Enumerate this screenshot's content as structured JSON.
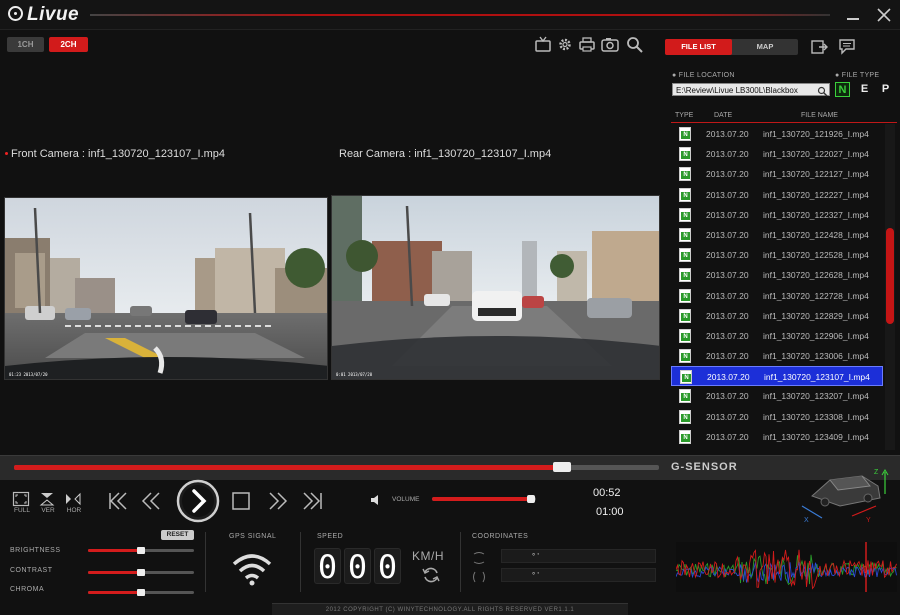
{
  "app": {
    "title": "Livue"
  },
  "window": {
    "minimize_icon": "minimize-icon",
    "close_icon": "close-icon"
  },
  "toolbar": {
    "channel_1": "1CH",
    "channel_2": "2CH",
    "tools": [
      "tv-icon",
      "settings-gear-icon",
      "printer-icon",
      "camera-icon",
      "search-icon"
    ]
  },
  "tabs": {
    "file_list": "FILE LIST",
    "map": "MAP"
  },
  "cameras": {
    "front_label": "Front Camera : inf1_130720_123107_I.mp4",
    "rear_label": "Rear Camera : inf1_130720_123107_I.mp4",
    "front_osd": "01:23 2013/07/20",
    "rear_osd": "0:01 2013/07/20"
  },
  "file_panel": {
    "location_label": "FILE LOCATION",
    "location_value": "E:\\Review\\Livue LB300L\\Blackbox",
    "file_type_label": "FILE TYPE",
    "file_types": [
      "N",
      "E",
      "P"
    ],
    "headers": {
      "type": "TYPE",
      "date": "DATE",
      "name": "FILE NAME"
    },
    "files": [
      {
        "date": "2013.07.20",
        "name": "inf1_130720_121926_I.mp4"
      },
      {
        "date": "2013.07.20",
        "name": "inf1_130720_122027_I.mp4"
      },
      {
        "date": "2013.07.20",
        "name": "inf1_130720_122127_I.mp4"
      },
      {
        "date": "2013.07.20",
        "name": "inf1_130720_122227_I.mp4"
      },
      {
        "date": "2013.07.20",
        "name": "inf1_130720_122327_I.mp4"
      },
      {
        "date": "2013.07.20",
        "name": "inf1_130720_122428_I.mp4"
      },
      {
        "date": "2013.07.20",
        "name": "inf1_130720_122528_I.mp4"
      },
      {
        "date": "2013.07.20",
        "name": "inf1_130720_122628_I.mp4"
      },
      {
        "date": "2013.07.20",
        "name": "inf1_130720_122728_I.mp4"
      },
      {
        "date": "2013.07.20",
        "name": "inf1_130720_122829_I.mp4"
      },
      {
        "date": "2013.07.20",
        "name": "inf1_130720_122906_I.mp4"
      },
      {
        "date": "2013.07.20",
        "name": "inf1_130720_123006_I.mp4"
      },
      {
        "date": "2013.07.20",
        "name": "inf1_130720_123107_I.mp4"
      },
      {
        "date": "2013.07.20",
        "name": "inf1_130720_123207_I.mp4"
      },
      {
        "date": "2013.07.20",
        "name": "inf1_130720_123308_I.mp4"
      },
      {
        "date": "2013.07.20",
        "name": "inf1_130720_123409_I.mp4"
      }
    ],
    "selected_index": 12,
    "scroll_position": 0.45
  },
  "playback": {
    "progress": 0.85,
    "elapsed": "00:52",
    "total": "01:00",
    "volume_label": "VOLUME",
    "volume": 0.95,
    "view_modes": [
      "FULL",
      "VER",
      "HOR"
    ]
  },
  "gsensor": {
    "title": "G-SENSOR",
    "axes": [
      "X",
      "Y",
      "Z"
    ]
  },
  "adjustments": {
    "reset_label": "RESET",
    "brightness_label": "BRIGHTNESS",
    "brightness": 0.5,
    "contrast_label": "CONTRAST",
    "contrast": 0.5,
    "chroma_label": "CHROMA",
    "chroma": 0.5
  },
  "gps": {
    "label": "GPS SIGNAL"
  },
  "speed": {
    "label": "SPEED",
    "digits": [
      "0",
      "0",
      "0"
    ],
    "unit": "KM/H"
  },
  "coordinates": {
    "label": "COORDINATES",
    "latitude": "°      '",
    "longitude": "°      '"
  },
  "footer": {
    "copyright": "2012 COPYRIGHT (C) WINYTECHNOLOGY.ALL RIGHTS RESERVED VER1.1.1"
  },
  "colors": {
    "accent": "#d21b1b",
    "selection": "#1c2fd8",
    "file_type_active": "#3bd13b"
  }
}
